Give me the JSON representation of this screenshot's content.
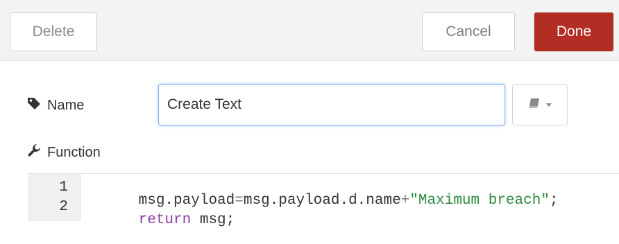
{
  "toolbar": {
    "delete_label": "Delete",
    "cancel_label": "Cancel",
    "done_label": "Done",
    "done_color": "#b22d23"
  },
  "form": {
    "name_label": "Name",
    "name_value": "Create Text",
    "name_icon": "tag-icon",
    "library_icon": "book-icon",
    "function_label": "Function",
    "function_icon": "wrench-icon"
  },
  "editor": {
    "lines": [
      {
        "number": "1",
        "tokens": [
          {
            "text": "msg.payload",
            "kind": "plain"
          },
          {
            "text": "=",
            "kind": "op"
          },
          {
            "text": "msg.payload.d.name",
            "kind": "plain"
          },
          {
            "text": "+",
            "kind": "op"
          },
          {
            "text": "\"Maximum breach\"",
            "kind": "str"
          },
          {
            "text": ";",
            "kind": "plain"
          }
        ]
      },
      {
        "number": "2",
        "tokens": [
          {
            "text": "return",
            "kind": "kw"
          },
          {
            "text": " msg;",
            "kind": "plain"
          }
        ]
      }
    ]
  }
}
